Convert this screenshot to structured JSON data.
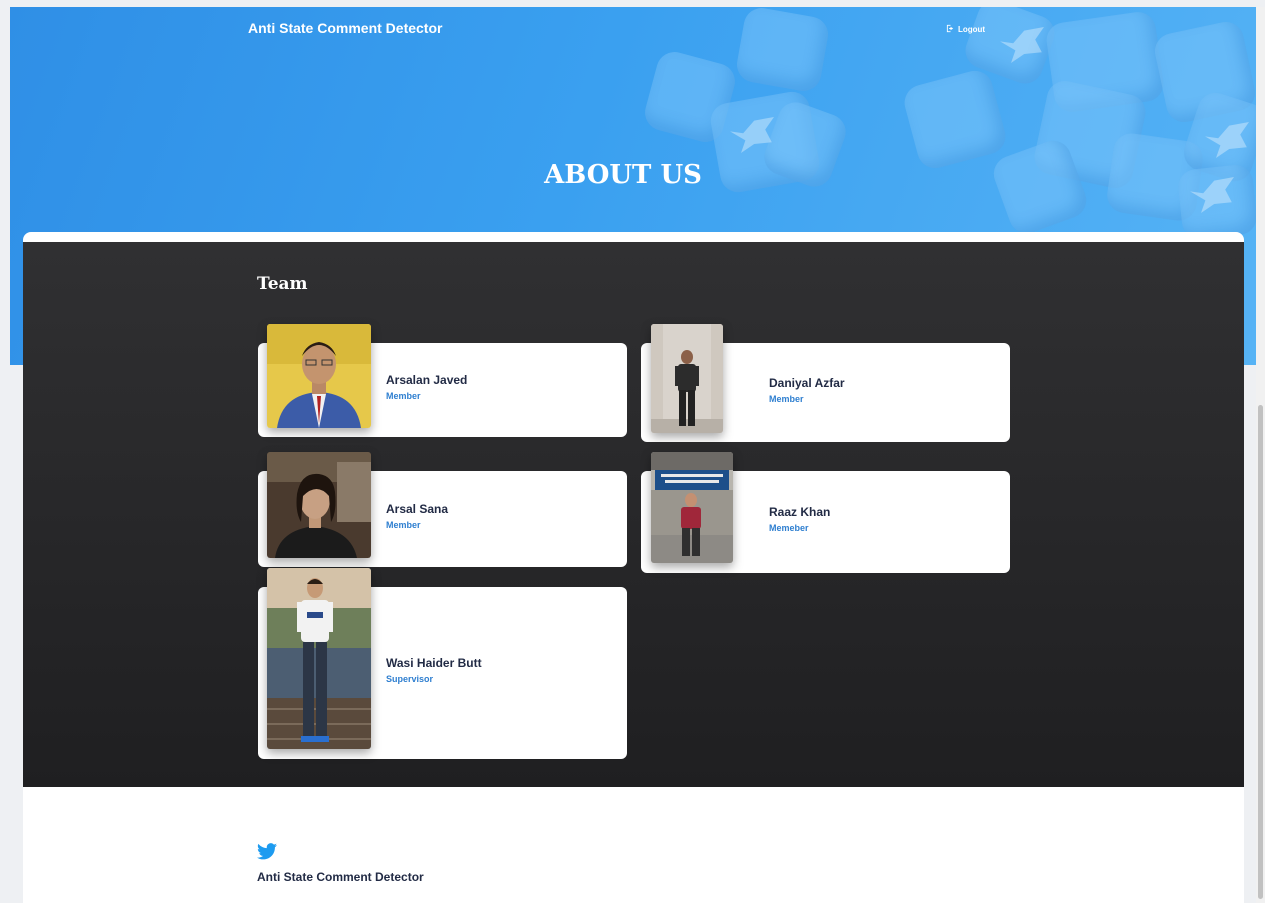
{
  "header": {
    "brand": "Anti State Comment Detector",
    "logout_label": "Logout",
    "logout_icon": "logout-icon",
    "title": "ABOUT US"
  },
  "team": {
    "heading": "Team",
    "members": [
      {
        "name": "Arsalan Javed",
        "role": "Member"
      },
      {
        "name": "Daniyal Azfar",
        "role": "Member"
      },
      {
        "name": "Arsal Sana",
        "role": "Member"
      },
      {
        "name": "Raaz Khan",
        "role": "Memeber"
      },
      {
        "name": "Wasi Haider Butt",
        "role": "Supervisor"
      }
    ]
  },
  "footer": {
    "icon": "twitter-icon",
    "text": "Anti State Comment Detector"
  },
  "colors": {
    "hero": "#3aa0f0",
    "accent": "#2f7fd0",
    "dark_panel": "#2a2a2c"
  }
}
